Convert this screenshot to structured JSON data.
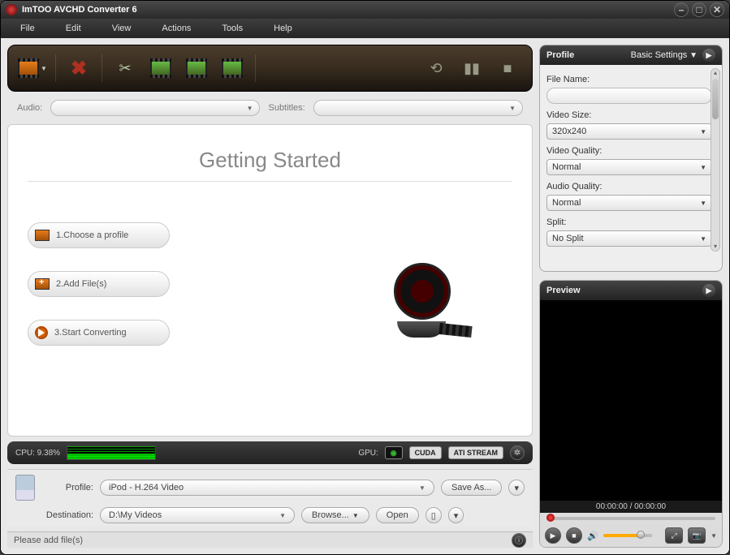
{
  "app": {
    "title": "ImTOO AVCHD Converter 6"
  },
  "menu": {
    "file": "File",
    "edit": "Edit",
    "view": "View",
    "actions": "Actions",
    "tools": "Tools",
    "help": "Help"
  },
  "audioSubs": {
    "audioLabel": "Audio:",
    "subtitlesLabel": "Subtitles:"
  },
  "gettingStarted": {
    "heading": "Getting Started",
    "step1": "1.Choose a profile",
    "step2": "2.Add File(s)",
    "step3": "3.Start Converting"
  },
  "sysbar": {
    "cpuLabel": "CPU: 9.38%",
    "gpuLabel": "GPU:",
    "cuda": "CUDA",
    "ati": "ATI STREAM"
  },
  "bottom": {
    "profileLabel": "Profile:",
    "profileValue": "iPod - H.264 Video",
    "saveAs": "Save As...",
    "destLabel": "Destination:",
    "destValue": "D:\\My Videos",
    "browse": "Browse...",
    "open": "Open"
  },
  "status": {
    "text": "Please add file(s)"
  },
  "profilePanel": {
    "title": "Profile",
    "basicSettings": "Basic Settings",
    "fileNameLabel": "File Name:",
    "videoSizeLabel": "Video Size:",
    "videoSizeValue": "320x240",
    "videoQualityLabel": "Video Quality:",
    "videoQualityValue": "Normal",
    "audioQualityLabel": "Audio Quality:",
    "audioQualityValue": "Normal",
    "splitLabel": "Split:",
    "splitValue": "No Split"
  },
  "previewPanel": {
    "title": "Preview",
    "time": "00:00:00 / 00:00:00"
  }
}
